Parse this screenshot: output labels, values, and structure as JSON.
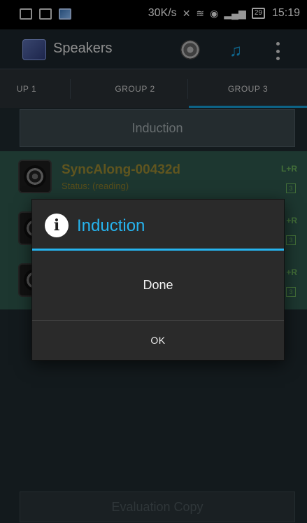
{
  "status_bar": {
    "net_speed": "30K/s",
    "battery": "29",
    "time": "15:19",
    "icons": [
      "notification-icon",
      "sim-icon",
      "image-icon",
      "silent-icon",
      "wifi-icon",
      "gps-icon",
      "signal-icon",
      "battery-icon"
    ]
  },
  "action_bar": {
    "app_title": "Speakers",
    "icons": [
      "speaker-icon",
      "music-icon",
      "overflow-menu-icon"
    ],
    "accent_color": "#19a6e6"
  },
  "tabs": [
    {
      "label": "UP 1"
    },
    {
      "label": "GROUP 2"
    },
    {
      "label": "GROUP 3",
      "selected": true
    }
  ],
  "content": {
    "induction_button": "Induction",
    "speakers": [
      {
        "name": "SyncAlong-00432d",
        "status": "Status: (reading)",
        "channel": "L+R",
        "badge": "3"
      },
      {
        "name": "",
        "status": "",
        "channel": "+R",
        "badge": "3"
      },
      {
        "name": "",
        "status": "",
        "channel": "+R",
        "badge": "3"
      }
    ],
    "evaluation_button": "Evaluation Copy"
  },
  "dialog": {
    "title": "Induction",
    "message": "Done",
    "ok_label": "OK",
    "title_color": "#26b4ef"
  }
}
